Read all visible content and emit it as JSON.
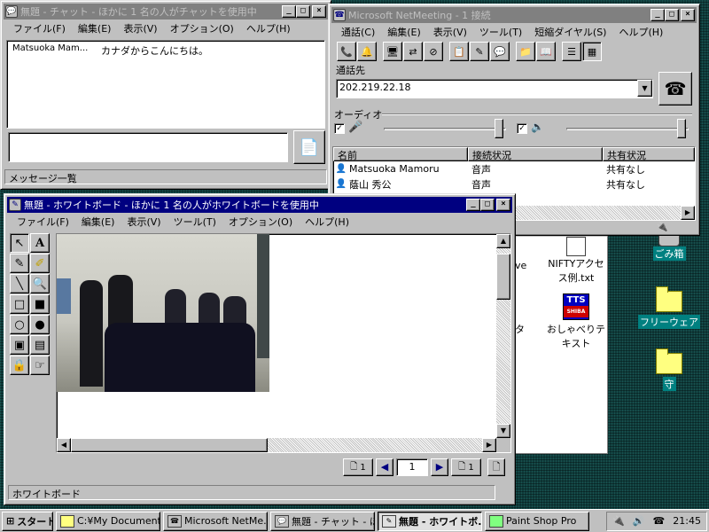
{
  "desktop": {
    "icons": [
      {
        "label": "ごみ箱"
      },
      {
        "label": "フリーウェア"
      },
      {
        "label": "守"
      },
      {
        "label": "NIFTYアクセス例.txt"
      },
      {
        "label": "おしゃべりテキスト"
      },
      {
        "label": "ve"
      },
      {
        "label": "タ"
      }
    ],
    "tts_badge": "TTS",
    "tts_badge2": "SHIBA"
  },
  "chat": {
    "title": "無題 - チャット - ほかに 1 名の人がチャットを使用中",
    "menu": [
      "ファイル(F)",
      "編集(E)",
      "表示(V)",
      "オプション(O)",
      "ヘルプ(H)"
    ],
    "messages": [
      {
        "sender": "Matsuoka Mam...",
        "text": "カナダからこんにちは。"
      }
    ],
    "input_value": "",
    "status": "メッセージ一覧"
  },
  "netmeeting": {
    "title": "Microsoft NetMeeting - 1 接続",
    "menu": [
      "通話(C)",
      "編集(E)",
      "表示(V)",
      "ツール(T)",
      "短縮ダイヤル(S)",
      "ヘルプ(H)"
    ],
    "call_label": "通話先",
    "address": "202.219.22.18",
    "audio_label": "オーディオ",
    "mic_level": 0.98,
    "speaker_level": 0.98,
    "columns": [
      "名前",
      "接続状況",
      "共有状況"
    ],
    "participants": [
      {
        "name": "Matsuoka Mamoru",
        "status": "音声",
        "share": "共有なし"
      },
      {
        "name": "蔭山 秀公",
        "status": "音声",
        "share": "共有なし"
      }
    ]
  },
  "whiteboard": {
    "title": "無題 - ホワイトボード - ほかに 1 名の人がホワイトボードを使用中",
    "menu": [
      "ファイル(F)",
      "編集(E)",
      "表示(V)",
      "ツール(T)",
      "オプション(O)",
      "ヘルプ(H)"
    ],
    "page_left": "1",
    "page_current": "1",
    "page_right": "1",
    "status": "ホワイトボード"
  },
  "taskbar": {
    "start": "スタート",
    "buttons": [
      {
        "label": "C:¥My Document..."
      },
      {
        "label": "Microsoft NetMe..."
      },
      {
        "label": "無題 - チャット - ほ..."
      },
      {
        "label": "無題 - ホワイトボ..."
      },
      {
        "label": "Paint Shop Pro"
      }
    ],
    "clock": "21:45"
  }
}
